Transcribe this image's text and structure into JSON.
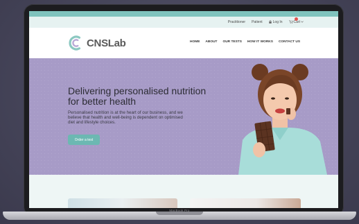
{
  "utility": {
    "practitioner": "Practitioner",
    "patient": "Patient",
    "login": "Log In",
    "cart": "Cart"
  },
  "brand": {
    "logo_text": "CNSLab",
    "color_primary": "#7fc3bd",
    "color_hero": "#a79bc7"
  },
  "nav": {
    "items": [
      "HOME",
      "ABOUT",
      "OUR TESTS",
      "HOW IT WORKS",
      "CONTACT US"
    ]
  },
  "hero": {
    "title": "Delivering personalised nutrition for better health",
    "text": "Personalised nutrition is at the heart of our business, and we believe that health and well-being is dependent on optimised diet and lifestyle choices.",
    "button": "Order a test"
  },
  "device": {
    "model": "MacBook Pro"
  }
}
